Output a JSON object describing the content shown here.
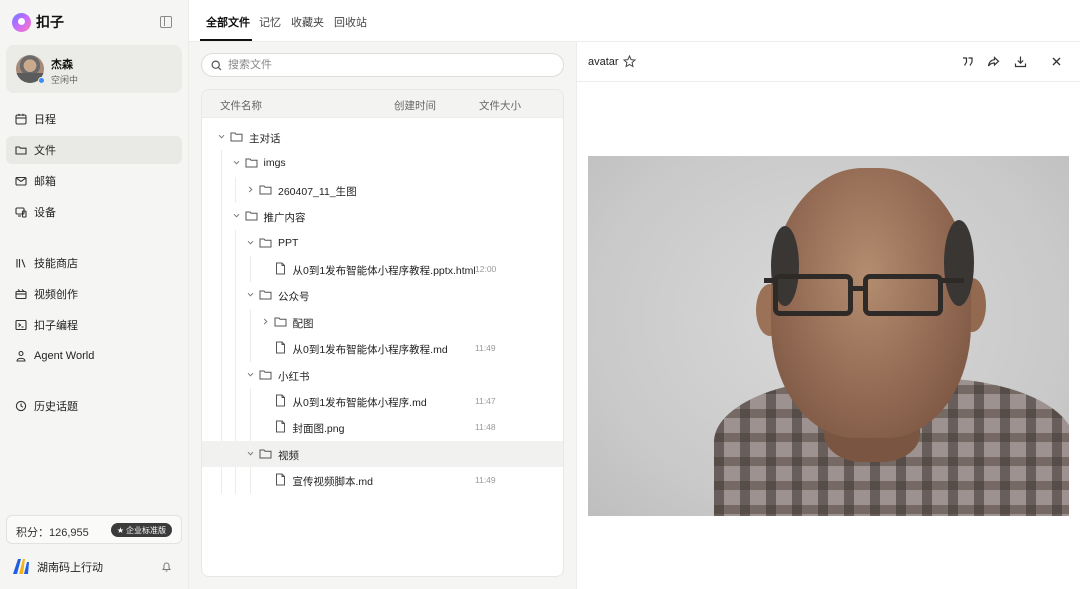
{
  "brand": {
    "name": "扣子"
  },
  "user": {
    "name": "杰森",
    "status": "空闲中"
  },
  "nav": {
    "items": [
      {
        "label": "日程",
        "icon": "calendar-icon"
      },
      {
        "label": "文件",
        "icon": "folder-icon",
        "active": true
      },
      {
        "label": "邮箱",
        "icon": "mail-icon"
      },
      {
        "label": "设备",
        "icon": "device-icon"
      },
      {
        "label": "技能商店",
        "icon": "library-icon"
      },
      {
        "label": "视频创作",
        "icon": "video-icon"
      },
      {
        "label": "扣子编程",
        "icon": "terminal-icon"
      },
      {
        "label": "Agent World",
        "icon": "agent-icon"
      },
      {
        "label": "历史话题",
        "icon": "history-icon"
      }
    ]
  },
  "credits": {
    "text": "积分：126,955",
    "badge": "企业标准版"
  },
  "org": {
    "name": "湖南码上行动"
  },
  "tabs": [
    {
      "label": "全部文件",
      "active": true
    },
    {
      "label": "记忆"
    },
    {
      "label": "收藏夹"
    },
    {
      "label": "回收站"
    }
  ],
  "search": {
    "placeholder": "搜索文件"
  },
  "table": {
    "col_name": "文件名称",
    "col_created": "创建时间",
    "col_size": "文件大小"
  },
  "tree": [
    {
      "depth": 0,
      "type": "folder",
      "open": true,
      "name": "主对话"
    },
    {
      "depth": 1,
      "type": "folder",
      "open": true,
      "name": "imgs"
    },
    {
      "depth": 2,
      "type": "folder",
      "open": false,
      "name": "260407_11_生图"
    },
    {
      "depth": 1,
      "type": "folder",
      "open": true,
      "name": "推广内容"
    },
    {
      "depth": 2,
      "type": "folder",
      "open": true,
      "name": "PPT"
    },
    {
      "depth": 3,
      "type": "file",
      "name": "从0到1发布智能体小程序教程.pptx.html",
      "time": "12:00"
    },
    {
      "depth": 2,
      "type": "folder",
      "open": true,
      "name": "公众号"
    },
    {
      "depth": 3,
      "type": "folder",
      "open": false,
      "name": "配图"
    },
    {
      "depth": 3,
      "type": "file",
      "name": "从0到1发布智能体小程序教程.md",
      "time": "11:49"
    },
    {
      "depth": 2,
      "type": "folder",
      "open": true,
      "name": "小红书"
    },
    {
      "depth": 3,
      "type": "file",
      "name": "从0到1发布智能体小程序.md",
      "time": "11:47"
    },
    {
      "depth": 3,
      "type": "file",
      "name": "封面图.png",
      "time": "11:48"
    },
    {
      "depth": 2,
      "type": "folder",
      "open": true,
      "name": "视频",
      "highlighted": true
    },
    {
      "depth": 3,
      "type": "file",
      "name": "宣传视频脚本.md",
      "time": "11:49"
    }
  ],
  "preview": {
    "title": "avatar"
  },
  "colors": {
    "accent": "#3b8df7",
    "sidebar_bg": "#f5f5f3",
    "badge_bg": "#3b3b3b"
  }
}
